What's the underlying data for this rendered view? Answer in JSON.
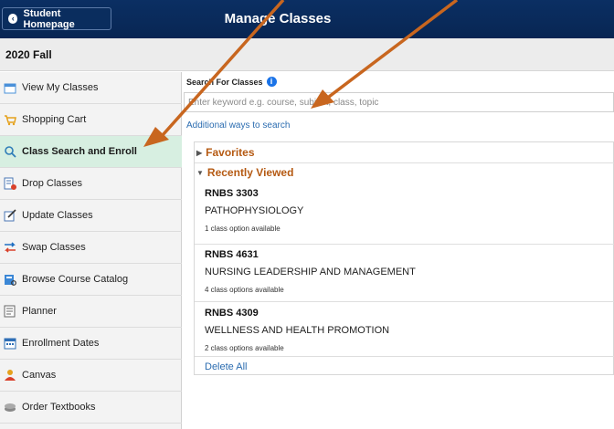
{
  "header": {
    "home_button": "Student Homepage",
    "title": "Manage Classes"
  },
  "term": "2020 Fall",
  "sidebar": {
    "items": [
      {
        "label": "View My Classes",
        "icon": "calendar-icon"
      },
      {
        "label": "Shopping Cart",
        "icon": "cart-icon"
      },
      {
        "label": "Class Search and Enroll",
        "icon": "search-icon",
        "active": true
      },
      {
        "label": "Drop Classes",
        "icon": "drop-icon"
      },
      {
        "label": "Update Classes",
        "icon": "edit-icon"
      },
      {
        "label": "Swap Classes",
        "icon": "swap-icon"
      },
      {
        "label": "Browse Course Catalog",
        "icon": "catalog-icon"
      },
      {
        "label": "Planner",
        "icon": "planner-icon"
      },
      {
        "label": "Enrollment Dates",
        "icon": "calendar-grid-icon"
      },
      {
        "label": "Canvas",
        "icon": "person-icon"
      },
      {
        "label": "Order Textbooks",
        "icon": "books-icon"
      }
    ]
  },
  "search": {
    "label": "Search For Classes",
    "placeholder": "Enter keyword e.g. course, subject, class, topic",
    "additional_link": "Additional ways to search"
  },
  "favorites": {
    "label": "Favorites"
  },
  "recently_viewed": {
    "label": "Recently Viewed",
    "items": [
      {
        "code": "RNBS 3303",
        "title": "PATHOPHYSIOLOGY",
        "options": "1 class option available"
      },
      {
        "code": "RNBS 4631",
        "title": "NURSING LEADERSHIP AND MANAGEMENT",
        "options": "4 class options available"
      },
      {
        "code": "RNBS 4309",
        "title": "WELLNESS AND HEALTH PROMOTION",
        "options": "2 class options available"
      }
    ],
    "delete_all": "Delete All"
  },
  "colors": {
    "header_bg": "#0b2f63",
    "active_item_bg": "#d7efe1",
    "section_heading": "#b55a13",
    "link": "#2b6cb0",
    "annotation_arrow": "#c8661f"
  }
}
